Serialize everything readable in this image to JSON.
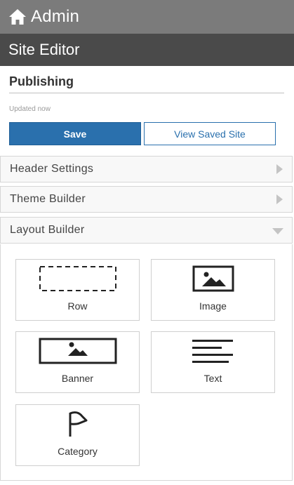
{
  "header": {
    "title": "Admin",
    "icon": "home-icon"
  },
  "editor": {
    "title": "Site Editor"
  },
  "publishing": {
    "title": "Publishing",
    "status": "Updated now",
    "save_label": "Save",
    "view_label": "View Saved Site"
  },
  "sections": [
    {
      "label": "Header Settings",
      "state": "collapsed"
    },
    {
      "label": "Theme Builder",
      "state": "collapsed"
    },
    {
      "label": "Layout Builder",
      "state": "expanded"
    }
  ],
  "layout_builder": {
    "blocks": [
      {
        "label": "Row",
        "icon": "row-icon"
      },
      {
        "label": "Image",
        "icon": "image-icon"
      },
      {
        "label": "Banner",
        "icon": "banner-icon"
      },
      {
        "label": "Text",
        "icon": "text-icon"
      },
      {
        "label": "Category",
        "icon": "flag-icon"
      }
    ]
  },
  "colors": {
    "primary": "#2a70ad",
    "topbar": "#7b7b7b",
    "editorbar": "#4a4a4a"
  }
}
